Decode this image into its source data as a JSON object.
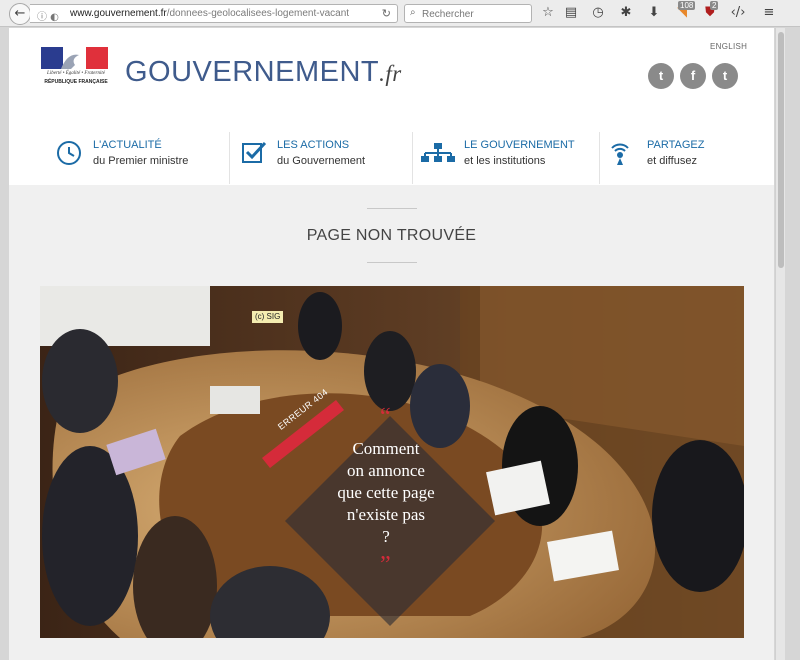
{
  "browser": {
    "url_domain": "www.gouvernement.fr",
    "url_path": "/donnees-geolocalisees-logement-vacant",
    "search_placeholder": "Rechercher",
    "rss_count": "108",
    "shield_count": "2"
  },
  "header": {
    "rf_motto": "Liberté • Égalité • Fraternité",
    "rf_name": "RÉPUBLIQUE FRANÇAISE",
    "wordmark": "GOUVERNEMENT",
    "wordmark_tld": ".fr",
    "english_label": "ENGLISH",
    "social": [
      {
        "icon": "twitter-icon",
        "glyph": "t"
      },
      {
        "icon": "facebook-icon",
        "glyph": "f"
      },
      {
        "icon": "tumblr-icon",
        "glyph": "t"
      }
    ]
  },
  "nav": [
    {
      "title": "L'ACTUALITÉ",
      "subtitle": "du Premier ministre",
      "icon": "clock-icon"
    },
    {
      "title": "LES ACTIONS",
      "subtitle": "du Gouvernement",
      "icon": "checkbox-icon"
    },
    {
      "title": "LE GOUVERNEMENT",
      "subtitle": "et les institutions",
      "icon": "org-chart-icon"
    },
    {
      "title": "PARTAGEZ",
      "subtitle": "et diffusez",
      "icon": "broadcast-icon"
    }
  ],
  "page": {
    "title": "PAGE NON TROUVÉE"
  },
  "photo": {
    "credit": "(c) SIG",
    "error_label": "ERREUR 404",
    "quote_open": "“",
    "quote_close": "”",
    "message_lines": [
      "Comment",
      "on annonce",
      "que cette page",
      "n'existe pas",
      "?"
    ]
  },
  "colors": {
    "accent_blue": "#1b6ba6",
    "wordmark_blue": "#3f5b8c",
    "error_red": "#d52b3a",
    "social_grey": "#8a8a8a"
  }
}
